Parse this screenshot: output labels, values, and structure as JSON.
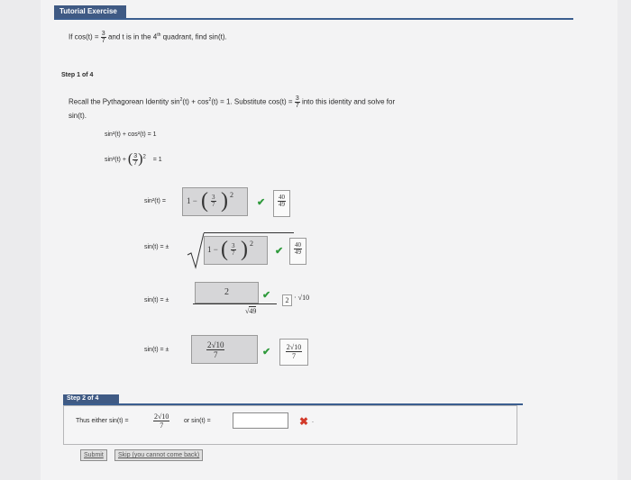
{
  "header": {
    "title": "Tutorial Exercise"
  },
  "problem": {
    "prefix": "If  cos(t) =",
    "frac_num": "3",
    "frac_den": "7",
    "mid": " and t is in the 4",
    "ordinal": "th",
    "suffix": " quadrant, find sin(t)."
  },
  "step1": {
    "label": "Step 1 of 4",
    "recall_a": "Recall the Pythagorean Identity  sin",
    "recall_b": "(t) + cos",
    "recall_c": "(t) = 1.  Substitute  cos(t) =",
    "recall_d": " into this identity and solve for",
    "recall_line2": "sin(t).",
    "eq1": "sin²(t) + cos²(t)  =  1",
    "eq2_lhs": "sin²(t) +",
    "eq2_rhs": "=  1",
    "row1_lhs": "sin²(t)  =",
    "row2_lhs": "sin(t)  =  ±",
    "row3_lhs": "sin(t)  =  ±",
    "row4_lhs": "sin(t)  =  ±",
    "one_minus": "1 −",
    "exp2": "2",
    "ans1_num": "40",
    "ans1_den": "49",
    "ans2_num": "40",
    "ans2_den": "49",
    "row3_box_value": "2",
    "row3_den": "49",
    "row3_ans_value": "2",
    "row3_ans_tail": "√10",
    "row4_box_num": "2√10",
    "row4_box_den": "7",
    "ans4_num": "2√10",
    "ans4_den": "7"
  },
  "step2": {
    "label": "Step 2 of 4",
    "text_a": "Thus either  sin(t) =",
    "frac_num": "2√10",
    "frac_den": "7",
    "text_b": " or  sin(t) =",
    "input_value": ""
  },
  "buttons": {
    "submit": "Submit",
    "skip": "Skip (you cannot come back)"
  }
}
